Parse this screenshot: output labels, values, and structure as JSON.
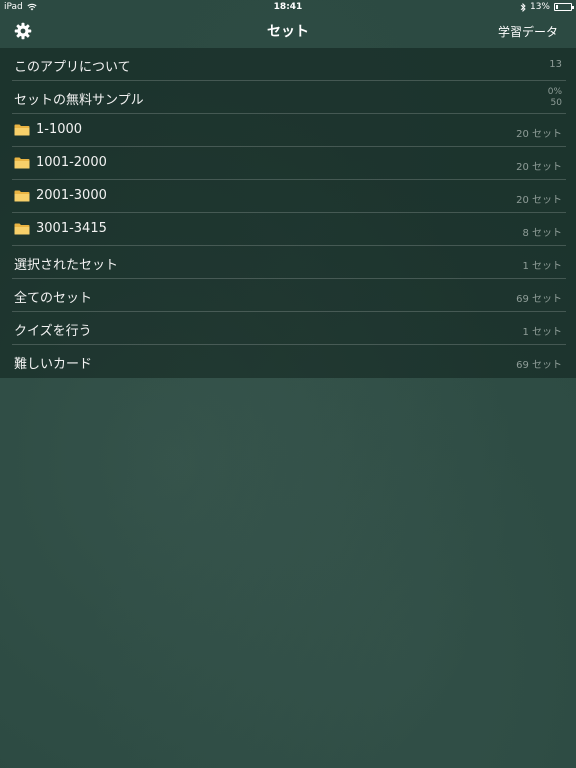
{
  "status_bar": {
    "device": "iPad",
    "time": "18:41",
    "battery_text": "13%",
    "battery_level": 0.13
  },
  "nav": {
    "title": "セット",
    "right_button": "学習データ",
    "left_icon": "gear-icon"
  },
  "rows": [
    {
      "label": "このアプリについて",
      "detail": "13",
      "icon": null
    },
    {
      "label": "セットの無料サンプル",
      "detail_top": "0%",
      "detail_bottom": "50",
      "icon": null
    },
    {
      "label": "1-1000",
      "detail": "20 セット",
      "icon": "folder-icon"
    },
    {
      "label": "1001-2000",
      "detail": "20 セット",
      "icon": "folder-icon"
    },
    {
      "label": "2001-3000",
      "detail": "20 セット",
      "icon": "folder-icon"
    },
    {
      "label": "3001-3415",
      "detail": "8 セット",
      "icon": "folder-icon"
    },
    {
      "label": "選択されたセット",
      "detail": "1 セット",
      "icon": null
    },
    {
      "label": "全てのセット",
      "detail": "69 セット",
      "icon": null
    },
    {
      "label": "クイズを行う",
      "detail": "1 セット",
      "icon": null
    },
    {
      "label": "難しいカード",
      "detail": "69 セット",
      "icon": null
    }
  ],
  "colors": {
    "background": "#2c4a42",
    "folder": "#f3c45a"
  }
}
